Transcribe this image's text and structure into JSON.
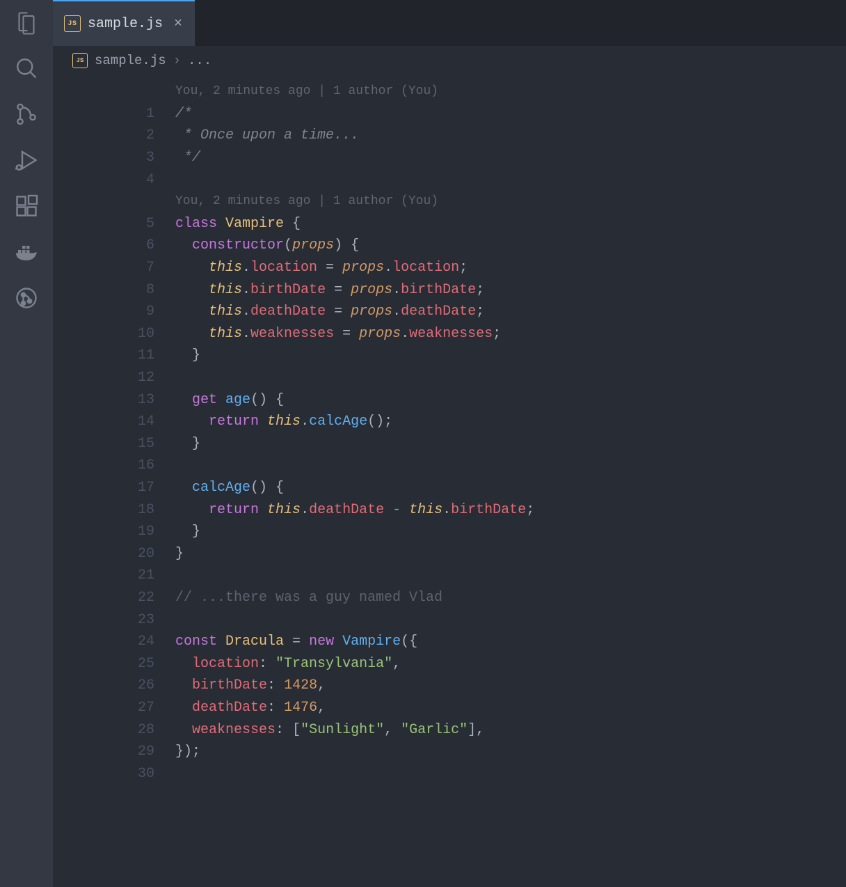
{
  "activityBar": {
    "items": [
      {
        "name": "explorer-icon"
      },
      {
        "name": "search-icon"
      },
      {
        "name": "source-control-icon"
      },
      {
        "name": "run-debug-icon"
      },
      {
        "name": "extensions-icon"
      },
      {
        "name": "docker-icon"
      },
      {
        "name": "gitlens-icon"
      }
    ]
  },
  "tab": {
    "badge": "JS",
    "filename": "sample.js",
    "closeGlyph": "×"
  },
  "breadcrumb": {
    "badge": "JS",
    "file": "sample.js",
    "sep": "›",
    "more": "..."
  },
  "codelens": {
    "line1": "You, 2 minutes ago | 1 author (You)",
    "line2": "You, 2 minutes ago | 1 author (You)"
  },
  "code": {
    "l1": "/*",
    "l2a": " * ",
    "l2b": "Once upon a time...",
    "l3": " */",
    "l5_class": "class",
    "l5_name": "Vampire",
    "l5_brace": " {",
    "l6_ctor": "constructor",
    "l6_open": "(",
    "l6_param": "props",
    "l6_close": ") {",
    "l7_this": "this",
    "l7_dot": ".",
    "l7_prop": "location",
    "l7_eq": " = ",
    "l7_param": "props",
    "l7_dot2": ".",
    "l7_src": "location",
    "l7_semi": ";",
    "l8_prop": "birthDate",
    "l8_src": "birthDate",
    "l9_prop": "deathDate",
    "l9_src": "deathDate",
    "l10_prop": "weaknesses",
    "l10_src": "weaknesses",
    "l11_brace": "}",
    "l13_get": "get",
    "l13_name": "age",
    "l13_rest": "() {",
    "l14_ret": "return",
    "l14_this": "this",
    "l14_dot": ".",
    "l14_fn": "calcAge",
    "l14_rest": "();",
    "l15_brace": "}",
    "l17_name": "calcAge",
    "l17_rest": "() {",
    "l18_ret": "return",
    "l18_this1": "this",
    "l18_d1": ".",
    "l18_p1": "deathDate",
    "l18_op": " - ",
    "l18_this2": "this",
    "l18_d2": ".",
    "l18_p2": "birthDate",
    "l18_semi": ";",
    "l19_brace": "}",
    "l20_brace": "}",
    "l22": "// ...there was a guy named Vlad",
    "l24_const": "const",
    "l24_name": "Dracula",
    "l24_eq": " = ",
    "l24_new": "new",
    "l24_cls": "Vampire",
    "l24_rest": "({",
    "l25_k": "location",
    "l25_c": ": ",
    "l25_v": "\"Transylvania\"",
    "l25_comma": ",",
    "l26_k": "birthDate",
    "l26_c": ": ",
    "l26_v": "1428",
    "l26_comma": ",",
    "l27_k": "deathDate",
    "l27_c": ": ",
    "l27_v": "1476",
    "l27_comma": ",",
    "l28_k": "weaknesses",
    "l28_c": ": ",
    "l28_open": "[",
    "l28_v1": "\"Sunlight\"",
    "l28_sep": ", ",
    "l28_v2": "\"Garlic\"",
    "l28_close": "]",
    "l28_comma": ",",
    "l29": "});"
  },
  "lineNumbers": [
    "1",
    "2",
    "3",
    "4",
    "5",
    "6",
    "7",
    "8",
    "9",
    "10",
    "11",
    "12",
    "13",
    "14",
    "15",
    "16",
    "17",
    "18",
    "19",
    "20",
    "21",
    "22",
    "23",
    "24",
    "25",
    "26",
    "27",
    "28",
    "29",
    "30"
  ]
}
